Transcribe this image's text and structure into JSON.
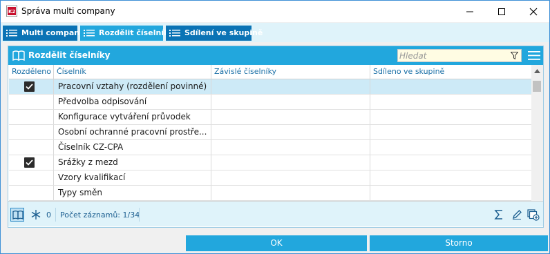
{
  "window": {
    "title": "Správa multi company",
    "controls": [
      "minimize-icon",
      "maximize-icon",
      "close-icon"
    ]
  },
  "tabs": [
    {
      "label": "Multi company",
      "icon": "list-icon",
      "active": false
    },
    {
      "label": "Rozdělit číselníky",
      "icon": "list-icon",
      "active": true
    },
    {
      "label": "Sdílení ve skupině",
      "icon": "list-icon",
      "active": false
    }
  ],
  "panel": {
    "title": "Rozdělit číselníky",
    "search_placeholder": "Hledat"
  },
  "table": {
    "columns": [
      "Rozděleno",
      "Číselník",
      "Závislé číselníky",
      "Sdíleno ve skupině"
    ],
    "rows": [
      {
        "checked": true,
        "name": "Pracovní vztahy (rozdělení povinné)",
        "dependent": "",
        "shared": "",
        "selected": true
      },
      {
        "checked": false,
        "name": "Předvolba odpisování",
        "dependent": "",
        "shared": "",
        "selected": false
      },
      {
        "checked": false,
        "name": "Konfigurace vytváření průvodek",
        "dependent": "",
        "shared": "",
        "selected": false
      },
      {
        "checked": false,
        "name": "Osobní ochranné pracovní prostře...",
        "dependent": "",
        "shared": "",
        "selected": false
      },
      {
        "checked": false,
        "name": "Číselník CZ-CPA",
        "dependent": "",
        "shared": "",
        "selected": false
      },
      {
        "checked": true,
        "name": "Srážky z mezd",
        "dependent": "",
        "shared": "",
        "selected": false
      },
      {
        "checked": false,
        "name": "Vzory kvalifikací",
        "dependent": "",
        "shared": "",
        "selected": false
      },
      {
        "checked": false,
        "name": "Typy směn",
        "dependent": "",
        "shared": "",
        "selected": false
      }
    ]
  },
  "footer": {
    "snowflake_count": "0",
    "records": "Počet záznamů: 1/34"
  },
  "buttons": {
    "ok": "OK",
    "cancel": "Storno"
  },
  "colors": {
    "accent": "#22a7dd",
    "tab_dark": "#0a73b5",
    "selected_row": "#cdeaf7",
    "footer_bg": "#dff3fa"
  }
}
